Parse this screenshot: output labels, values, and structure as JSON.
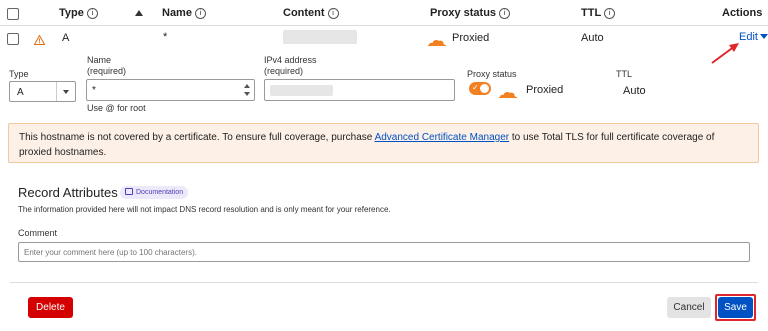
{
  "table": {
    "headers": {
      "type": "Type",
      "name": "Name",
      "content": "Content",
      "proxy_status": "Proxy status",
      "ttl": "TTL",
      "actions": "Actions"
    },
    "row": {
      "type": "A",
      "name": "*",
      "proxy_status": "Proxied",
      "ttl": "Auto",
      "edit_label": "Edit"
    }
  },
  "form": {
    "type_label": "Type",
    "type_value": "A",
    "name_label": "Name",
    "name_required": "(required)",
    "name_value": "*",
    "name_hint": "Use @ for root",
    "ipv4_label": "IPv4 address",
    "ipv4_required": "(required)",
    "proxy_label": "Proxy status",
    "proxy_value": "Proxied",
    "ttl_label": "TTL",
    "ttl_value": "Auto"
  },
  "warning": {
    "text_before": "This hostname is not covered by a certificate. To ensure full coverage, purchase ",
    "link": "Advanced Certificate Manager",
    "text_after": " to use Total TLS for full certificate coverage of proxied hostnames."
  },
  "attributes": {
    "title": "Record Attributes",
    "doc_badge": "Documentation",
    "description": "The information provided here will not impact DNS record resolution and is only meant for your reference.",
    "comment_label": "Comment",
    "comment_placeholder": "Enter your comment here (up to 100 characters)."
  },
  "footer": {
    "delete_label": "Delete",
    "cancel_label": "Cancel",
    "save_label": "Save"
  },
  "colors": {
    "accent_blue": "#0051c3",
    "cloudflare_orange": "#f38020",
    "delete_red": "#d40000",
    "warning_bg": "#fdf0e6",
    "warning_border": "#f0c8a0"
  }
}
